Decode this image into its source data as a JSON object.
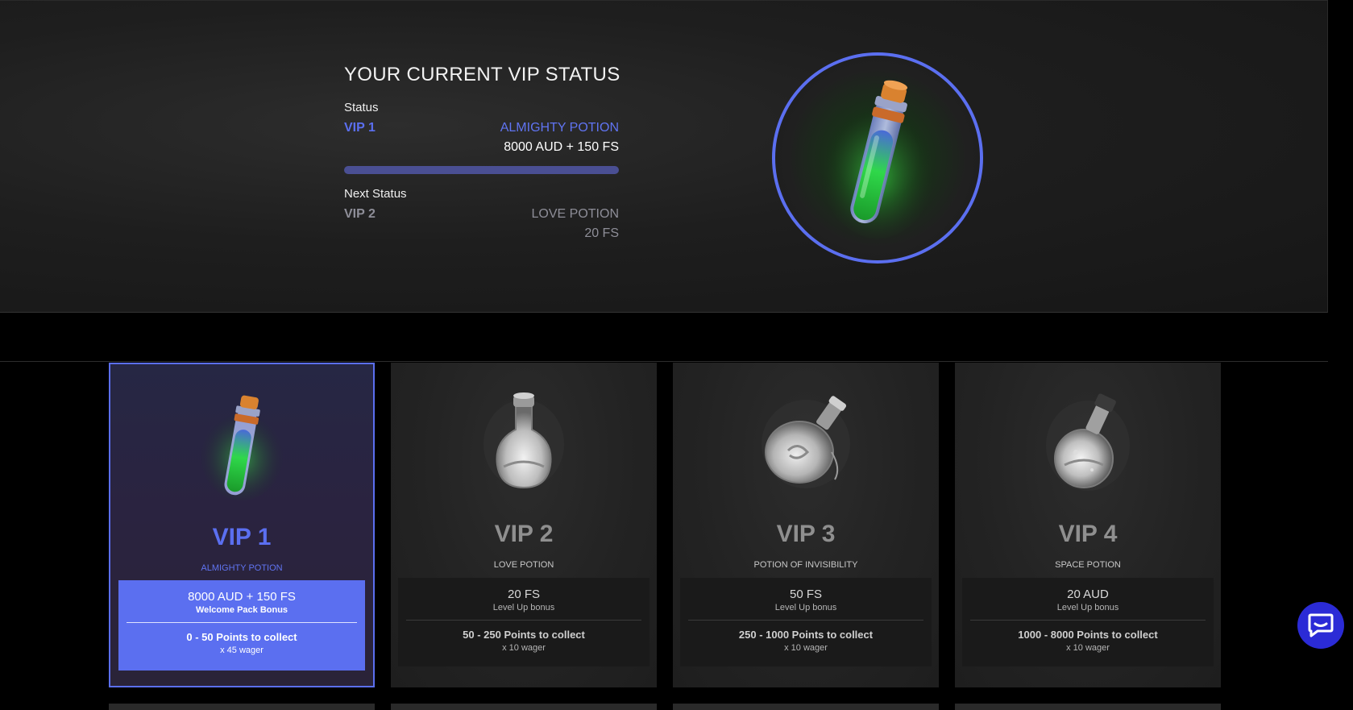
{
  "hero": {
    "title": "YOUR CURRENT VIP STATUS",
    "status_label": "Status",
    "current_vip": "VIP 1",
    "current_potion": "ALMIGHTY POTION",
    "current_reward": "8000 AUD + 150 FS",
    "progress_fraction": 1.0,
    "next_label": "Next Status",
    "next_vip": "VIP 2",
    "next_potion": "LOVE POTION",
    "next_reward": "20 FS"
  },
  "cards": [
    {
      "tier": "VIP 1",
      "potion": "ALMIGHTY POTION",
      "amount": "8000 AUD + 150 FS",
      "sub": "Welcome Pack Bonus",
      "points": "0 - 50 Points to collect",
      "wager": "x 45 wager",
      "active": true,
      "icon": "green-potion-icon"
    },
    {
      "tier": "VIP 2",
      "potion": "LOVE POTION",
      "amount": "20 FS",
      "sub": "Level Up bonus",
      "points": "50 - 250 Points to collect",
      "wager": "x 10 wager",
      "active": false,
      "icon": "round-flask-icon"
    },
    {
      "tier": "VIP 3",
      "potion": "POTION OF INVISIBILITY",
      "amount": "50 FS",
      "sub": "Level Up bonus",
      "points": "250 - 1000 Points to collect",
      "wager": "x 10 wager",
      "active": false,
      "icon": "flat-flask-icon"
    },
    {
      "tier": "VIP 4",
      "potion": "SPACE POTION",
      "amount": "20 AUD",
      "sub": "Level Up bonus",
      "points": "1000 - 8000 Points to collect",
      "wager": "x 10 wager",
      "active": false,
      "icon": "globe-flask-icon"
    }
  ],
  "colors": {
    "accent": "#5b6ff0",
    "chat": "#2b2bd6"
  },
  "chat_icon": "chat-bubble-icon"
}
